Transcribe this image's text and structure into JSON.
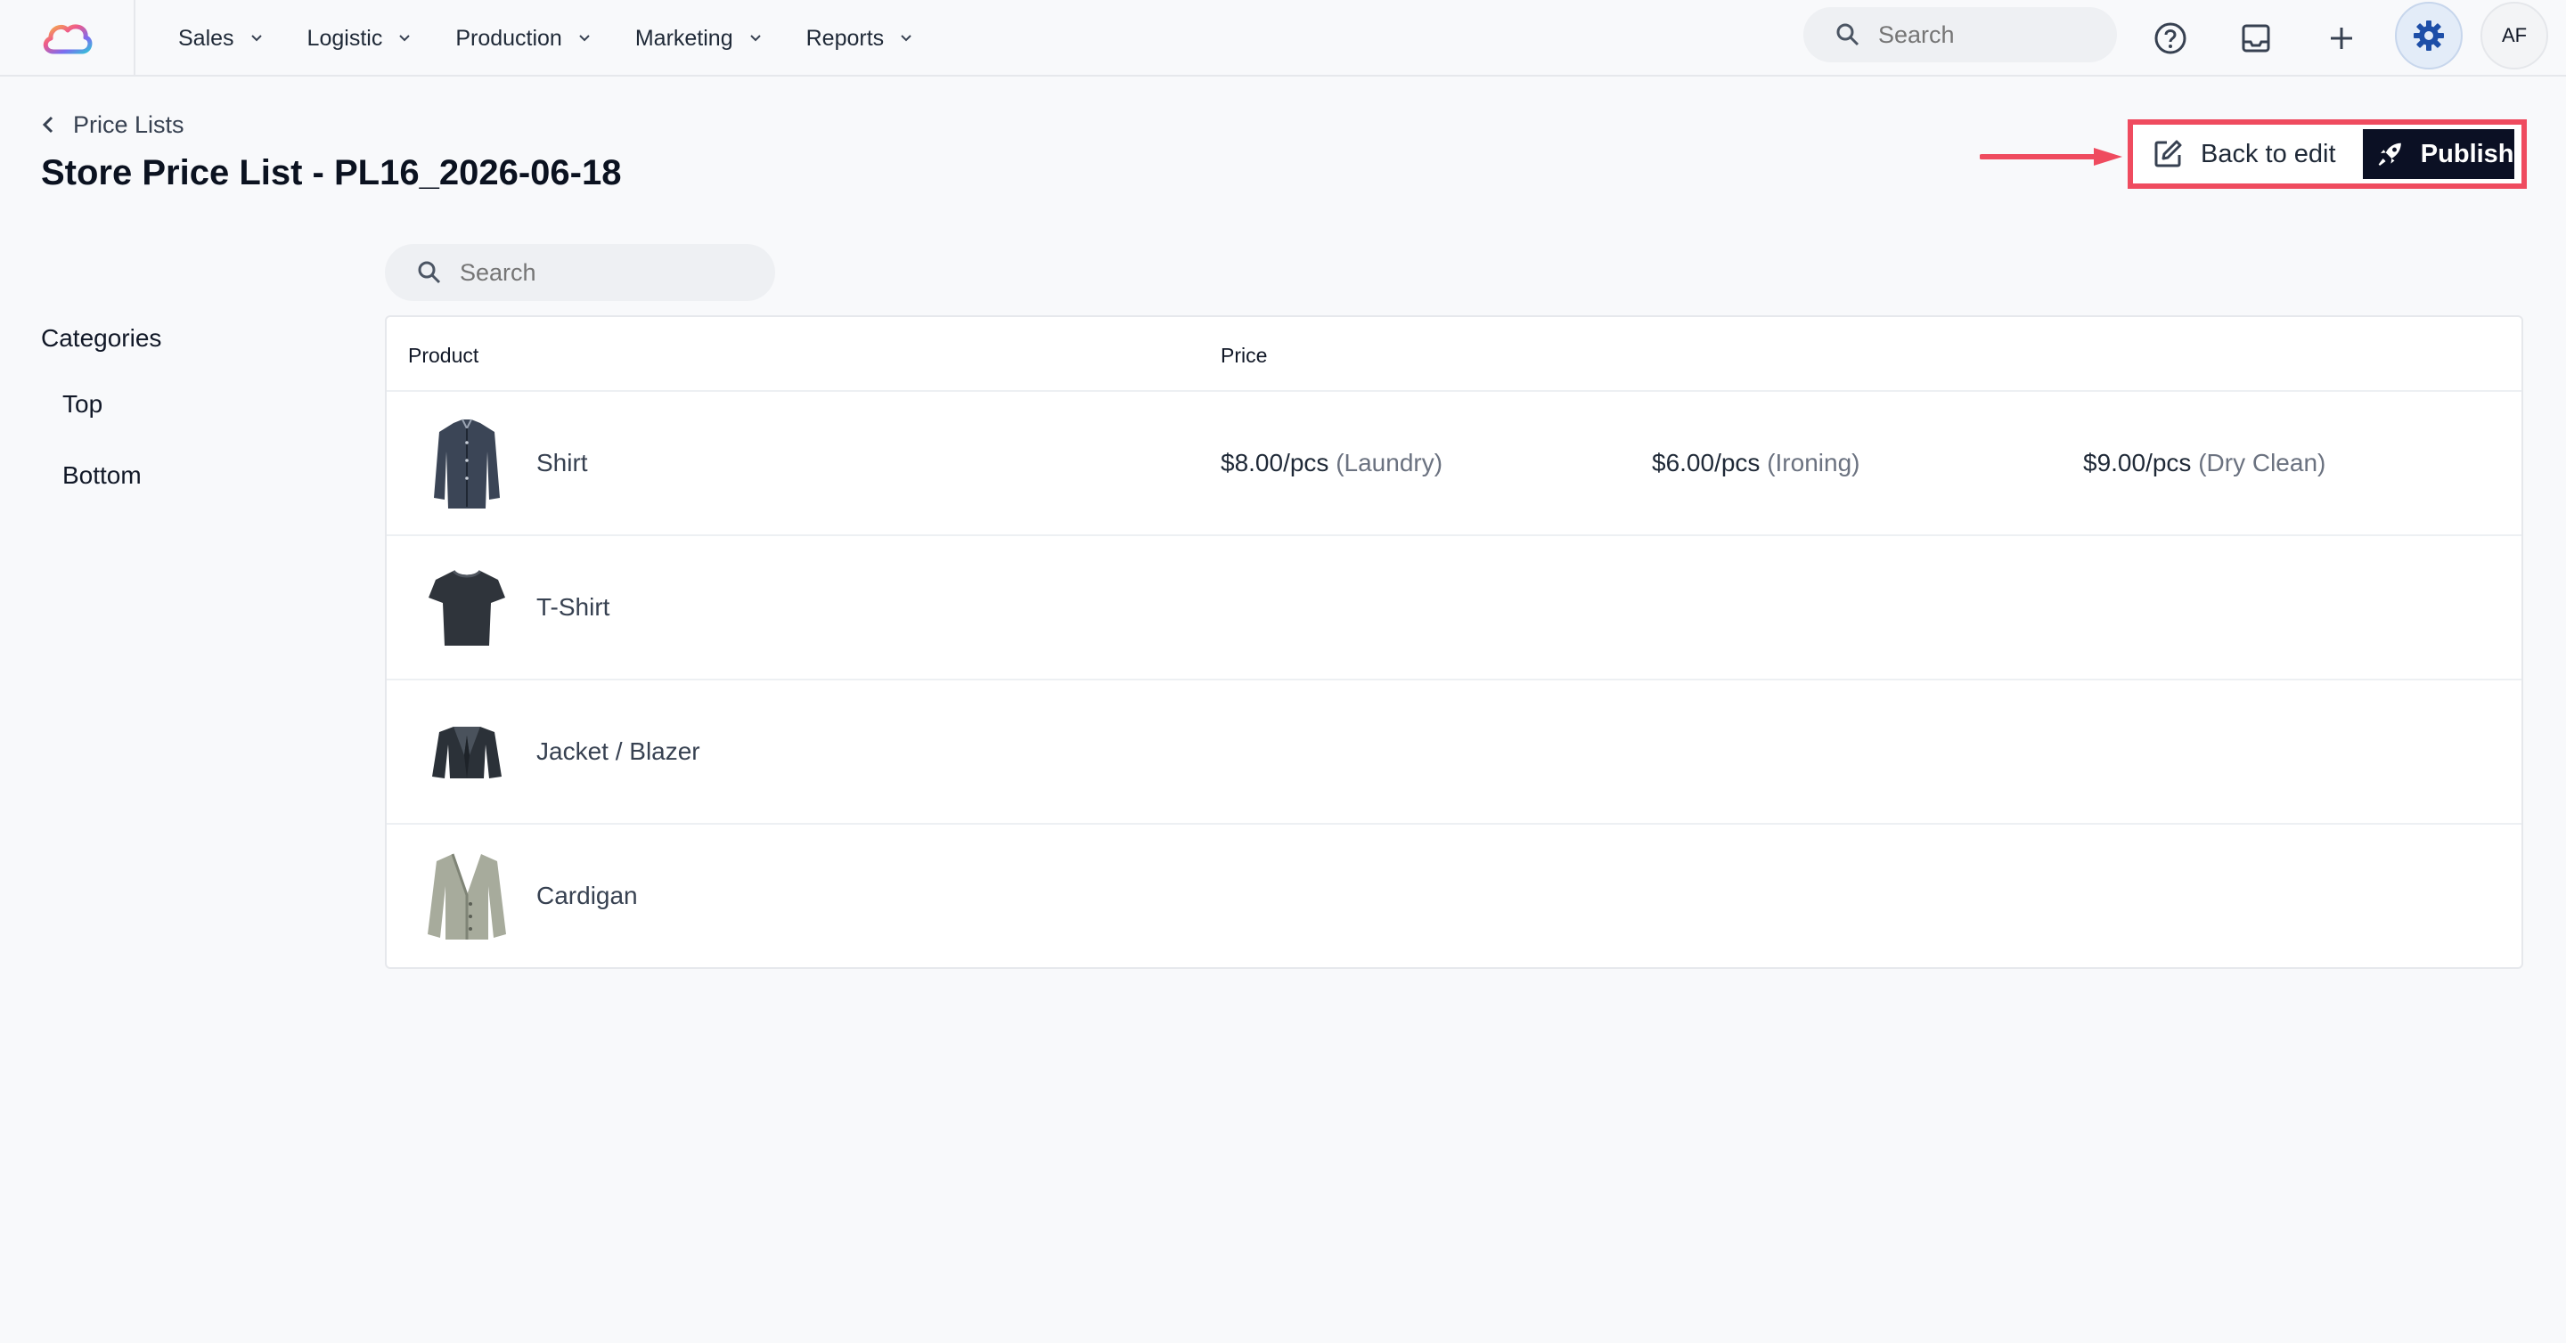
{
  "nav": {
    "items": [
      {
        "label": "Sales"
      },
      {
        "label": "Logistic"
      },
      {
        "label": "Production"
      },
      {
        "label": "Marketing"
      },
      {
        "label": "Reports"
      }
    ],
    "search_placeholder": "Search",
    "avatar_initials": "AF"
  },
  "header": {
    "breadcrumb": "Price Lists",
    "title": "Store Price List - PL16_2026-06-18",
    "back_to_edit_label": "Back to edit",
    "publish_label": "Publish"
  },
  "content": {
    "search_placeholder": "Search"
  },
  "categories": {
    "title": "Categories",
    "items": [
      "Top",
      "Bottom"
    ]
  },
  "table": {
    "columns": {
      "product": "Product",
      "price": "Price"
    },
    "rows": [
      {
        "product": "Shirt",
        "prices": [
          {
            "amount": "$8.00/pcs",
            "service": "(Laundry)"
          },
          {
            "amount": "$6.00/pcs",
            "service": "(Ironing)"
          },
          {
            "amount": "$9.00/pcs",
            "service": "(Dry Clean)"
          }
        ]
      },
      {
        "product": "T-Shirt",
        "prices": []
      },
      {
        "product": "Jacket / Blazer",
        "prices": []
      },
      {
        "product": "Cardigan",
        "prices": []
      }
    ]
  },
  "colors": {
    "highlight": "#ef4b5f",
    "publish_bg": "#0b1024",
    "gear_accent": "#1e4fa8"
  }
}
